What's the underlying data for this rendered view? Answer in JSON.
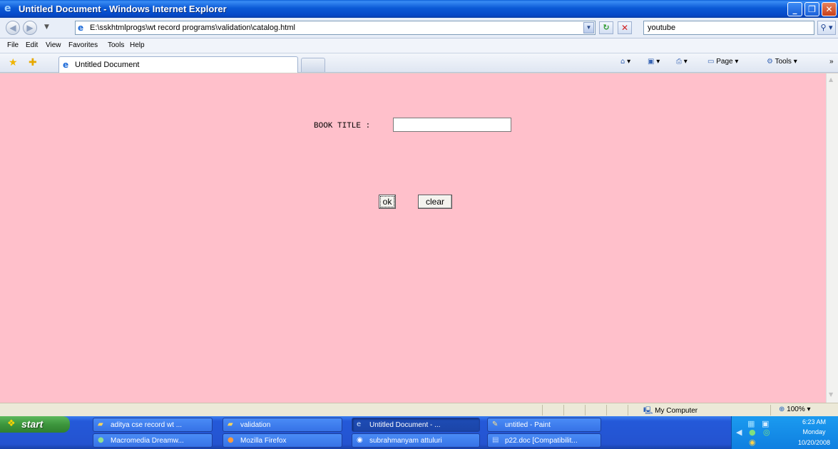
{
  "window": {
    "title": "Untitled Document - Windows Internet Explorer",
    "controls": {
      "minimize": "_",
      "maximize": "❐",
      "close": "✕"
    }
  },
  "addressbar": {
    "url": "E:\\sskhtmlprogs\\wt record programs\\validation\\catalog.html",
    "search_value": "youtube"
  },
  "menu": [
    "File",
    "Edit",
    "View",
    "Favorites",
    "Tools",
    "Help"
  ],
  "tabs": [
    {
      "label": "Untitled Document"
    }
  ],
  "commandbar": {
    "page": "Page",
    "tools": "Tools"
  },
  "form": {
    "book_title_label": "BOOK TITLE :",
    "book_title_value": "",
    "ok_label": "ok",
    "clear_label": "clear",
    "background": "#ffc0cb"
  },
  "status": {
    "zone": "My Computer",
    "zoom": "100%"
  },
  "taskbar": {
    "start_label": "start",
    "tasks_row1": [
      {
        "label": "aditya cse record wt ...",
        "icon": "folder-icon"
      },
      {
        "label": "validation",
        "icon": "folder-icon"
      },
      {
        "label": "Untitled Document - ...",
        "icon": "ie-icon",
        "active": true
      },
      {
        "label": "untitled - Paint",
        "icon": "paint-icon"
      }
    ],
    "tasks_row2": [
      {
        "label": "Macromedia Dreamw...",
        "icon": "dreamweaver-icon"
      },
      {
        "label": "Mozilla Firefox",
        "icon": "firefox-icon"
      },
      {
        "label": "subrahmanyam attuluri",
        "icon": "messenger-icon"
      },
      {
        "label": "p22.doc [Compatibilit...",
        "icon": "word-icon"
      }
    ],
    "clock": {
      "time": "6:23 AM",
      "day": "Monday",
      "date": "10/20/2008"
    }
  }
}
